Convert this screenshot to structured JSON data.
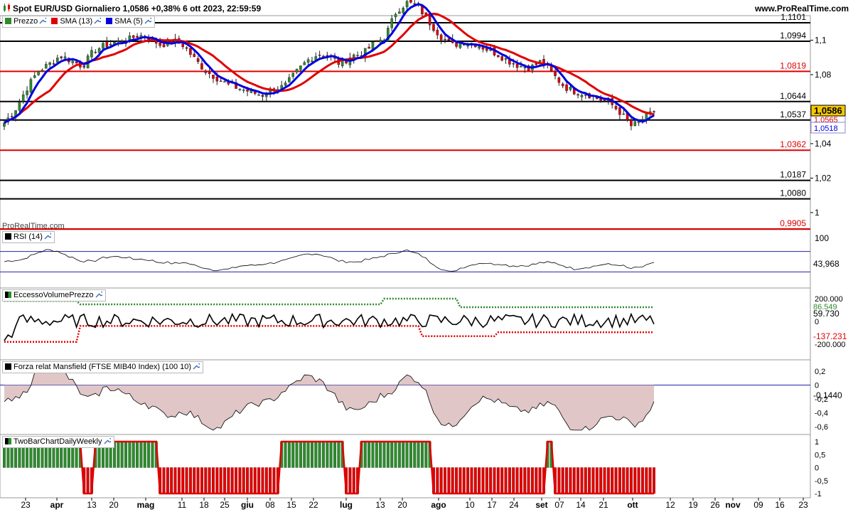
{
  "header": {
    "title": "Spot EUR/USD Giornaliero 1,0586 +0,38% 6 ott 2023, 22:59:59",
    "site": "www.ProRealTime.com",
    "watermark": "ProRealTime.com"
  },
  "price_panel": {
    "legend": [
      {
        "label": "Prezzo",
        "color": "#2e8b2e"
      },
      {
        "label": "SMA (13)",
        "color": "#e00000"
      },
      {
        "label": "SMA (5)",
        "color": "#0000e0"
      }
    ],
    "yaxis_ticks": [
      "1,1",
      "1,08",
      "1,06",
      "1,04",
      "1,02",
      "1"
    ],
    "levels": [
      {
        "value": 1.1101,
        "label": "1,1101",
        "color": "#000000"
      },
      {
        "value": 1.0994,
        "label": "1,0994",
        "color": "#000000"
      },
      {
        "value": 1.0819,
        "label": "1,0819",
        "color": "#e00000"
      },
      {
        "value": 1.0644,
        "label": "1,0644",
        "color": "#000000"
      },
      {
        "value": 1.0537,
        "label": "1,0537",
        "color": "#000000"
      },
      {
        "value": 1.0362,
        "label": "1,0362",
        "color": "#e00000"
      },
      {
        "value": 1.0187,
        "label": "1,0187",
        "color": "#000000"
      },
      {
        "value": 1.008,
        "label": "1,0080",
        "color": "#000000"
      },
      {
        "value": 0.9905,
        "label": "0,9905",
        "color": "#e00000"
      }
    ],
    "last_price": "1,0586",
    "sma13_last": "1,0565",
    "sma5_last": "1,0518"
  },
  "rsi_panel": {
    "title": "RSI (14)",
    "y_tick": "100",
    "last": "43,968",
    "bands": [
      70,
      30
    ]
  },
  "evp_panel": {
    "title": "EccessoVolumePrezzo",
    "ticks": [
      "200.000",
      "0",
      "-200.000"
    ],
    "upper": "86.549",
    "last": "59.730",
    "lower": "-137.231"
  },
  "mansfield_panel": {
    "title": "Forza relat Mansfield (FTSE MIB40 Index) (100 10)",
    "ticks": [
      "0,2",
      "0",
      "-0,2",
      "-0,4",
      "-0,6"
    ],
    "last": "-0,1440"
  },
  "twobar_panel": {
    "title": "TwoBarChartDailyWeekly",
    "ticks": [
      "1",
      "0,5",
      "0",
      "-0,5",
      "-1"
    ],
    "top_label": "1",
    "bottom_label": "-1"
  },
  "xaxis": [
    "23",
    "apr",
    "13",
    "20",
    "mag",
    "11",
    "18",
    "25",
    "giu",
    "08",
    "15",
    "22",
    "lug",
    "13",
    "20",
    "ago",
    "10",
    "17",
    "24",
    "set",
    "07",
    "14",
    "21",
    "ott",
    "12",
    "19",
    "26",
    "nov",
    "09",
    "16",
    "23"
  ],
  "chart_data": {
    "type": "candlestick",
    "title": "Spot EUR/USD Giornaliero",
    "series": [
      {
        "name": "Prezzo",
        "sampled_closes": [
          1.052,
          1.06,
          1.072,
          1.082,
          1.086,
          1.091,
          1.088,
          1.085,
          1.094,
          1.097,
          1.099,
          1.1,
          1.103,
          1.101,
          1.097,
          1.1,
          1.097,
          1.089,
          1.082,
          1.078,
          1.074,
          1.072,
          1.07,
          1.068,
          1.072,
          1.073,
          1.081,
          1.088,
          1.092,
          1.091,
          1.086,
          1.091,
          1.092,
          1.098,
          1.102,
          1.117,
          1.122,
          1.119,
          1.11,
          1.102,
          1.097,
          1.099,
          1.098,
          1.095,
          1.092,
          1.088,
          1.085,
          1.084,
          1.088,
          1.08,
          1.073,
          1.07,
          1.069,
          1.066,
          1.064,
          1.058,
          1.05,
          1.054,
          1.0586
        ]
      },
      {
        "name": "SMA (13)",
        "color": "#e00000"
      },
      {
        "name": "SMA (5)",
        "color": "#0000e0"
      }
    ],
    "ylim": [
      0.99,
      1.115
    ]
  }
}
